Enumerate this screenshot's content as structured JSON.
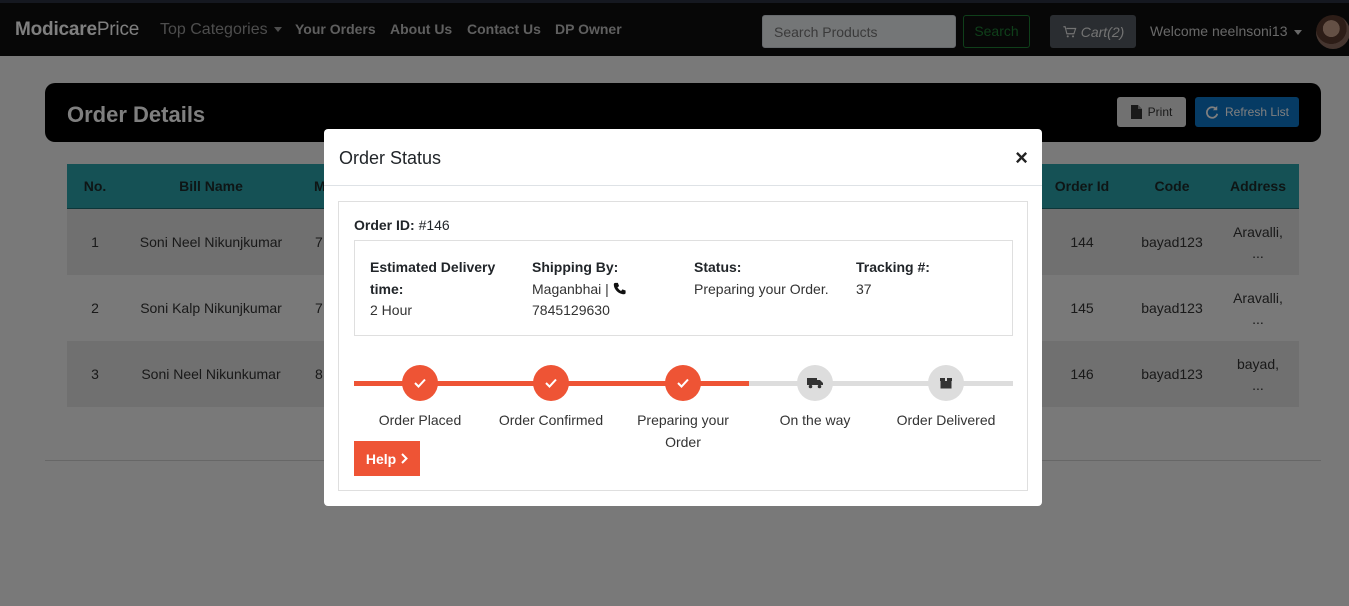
{
  "nav": {
    "brand_bold": "Modicare",
    "brand_light": "Price",
    "top_categories": "Top Categories",
    "your_orders": "Your Orders",
    "about_us": "About Us",
    "contact_us": "Contact Us",
    "dp_owner": "DP Owner",
    "search_placeholder": "Search Products",
    "search_button": "Search",
    "cart": "Cart(2)",
    "welcome": "Welcome neelnsoni13"
  },
  "page": {
    "title": "Order Details",
    "print_label": "Print",
    "refresh_label": "Refresh List"
  },
  "table": {
    "headers": {
      "no": "No.",
      "bill_name": "Bill Name",
      "partial": "M",
      "order_id": "Order Id",
      "code": "Code",
      "address": "Address"
    },
    "rows": [
      {
        "no": "1",
        "bill_name": "Soni Neel Nikunjkumar",
        "partial": "7",
        "order_id": "144",
        "code": "bayad123",
        "address_1": "Aravalli,",
        "address_2": "..."
      },
      {
        "no": "2",
        "bill_name": "Soni Kalp Nikunjkumar",
        "partial": "7",
        "order_id": "145",
        "code": "bayad123",
        "address_1": "Aravalli,",
        "address_2": "..."
      },
      {
        "no": "3",
        "bill_name": "Soni Neel Nikunkumar",
        "partial": "8",
        "order_id": "146",
        "code": "bayad123",
        "address_1": "bayad,",
        "address_2": "..."
      }
    ]
  },
  "modal": {
    "title": "Order Status",
    "close": "×",
    "order_id_label": "Order ID:",
    "order_id_value": "#146",
    "delivery_label_1": "Estimated Delivery",
    "delivery_label_2": "time:",
    "delivery_value": "2 Hour",
    "shipping_label": "Shipping By:",
    "shipping_name": "Maganbhai |",
    "shipping_phone": "7845129630",
    "status_label": "Status:",
    "status_value": "Preparing your Order.",
    "tracking_label": "Tracking #:",
    "tracking_value": "37",
    "progress_steps_completed": 3,
    "steps": [
      {
        "label": "Order Placed",
        "state": "done",
        "icon": "check-icon"
      },
      {
        "label": "Order Confirmed",
        "state": "done",
        "icon": "check-icon"
      },
      {
        "label_1": "Preparing your",
        "label_2": "Order",
        "state": "done",
        "icon": "check-icon"
      },
      {
        "label": "On the way",
        "state": "pending",
        "icon": "truck-icon"
      },
      {
        "label": "Order Delivered",
        "state": "pending",
        "icon": "box-icon"
      }
    ],
    "help_label": "Help"
  },
  "colors": {
    "accent": "#ee5435",
    "table_header": "#2aa2aa",
    "refresh": "#0d76c9"
  }
}
